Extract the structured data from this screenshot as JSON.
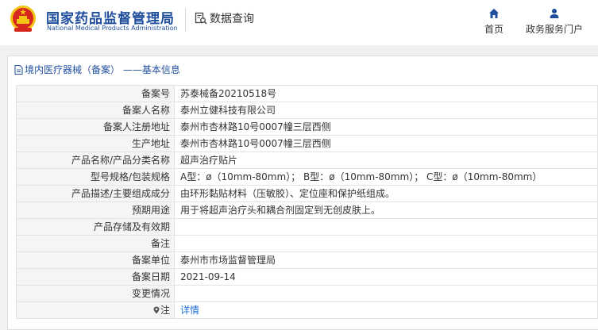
{
  "header": {
    "brand_cn": "国家药品监督管理局",
    "brand_en": "National Medical Products Administration",
    "query_label": "数据查询",
    "nav": [
      {
        "label": "首页",
        "icon": "home-icon"
      },
      {
        "label": "政务服务门户",
        "icon": "user-icon"
      }
    ]
  },
  "panel": {
    "title": "境内医疗器械（备案） ——基本信息"
  },
  "rows": [
    {
      "label": "备案号",
      "value": "苏泰械备20210518号"
    },
    {
      "label": "备案人名称",
      "value": "泰州立健科技有限公司"
    },
    {
      "label": "备案人注册地址",
      "value": "泰州市杏林路10号0007幢三层西侧"
    },
    {
      "label": "生产地址",
      "value": "泰州市杏林路10号0007幢三层西侧"
    },
    {
      "label": "产品名称/产品分类名称",
      "value": "超声治疗贴片"
    },
    {
      "label": "型号规格/包装规格",
      "value": "A型：ø（10mm-80mm）； B型：ø（10mm-80mm）； C型：ø（10mm-80mm）"
    },
    {
      "label": "产品描述/主要组成成分",
      "value": "由环形黏贴材料（压敏胶）、定位座和保护纸组成。"
    },
    {
      "label": "预期用途",
      "value": "用于将超声治疗头和耦合剂固定到无创皮肤上。"
    },
    {
      "label": "产品存储及有效期",
      "value": ""
    },
    {
      "label": "备注",
      "value": ""
    },
    {
      "label": "备案单位",
      "value": "泰州市市场监督管理局"
    },
    {
      "label": "备案日期",
      "value": "2021-09-14"
    },
    {
      "label": "变更情况",
      "value": ""
    },
    {
      "label": "注",
      "value": "详情"
    }
  ],
  "colors": {
    "brand": "#1f4e9c",
    "link": "#1f6fd0",
    "emblem_red": "#d7261e",
    "emblem_gold": "#f3c315"
  }
}
